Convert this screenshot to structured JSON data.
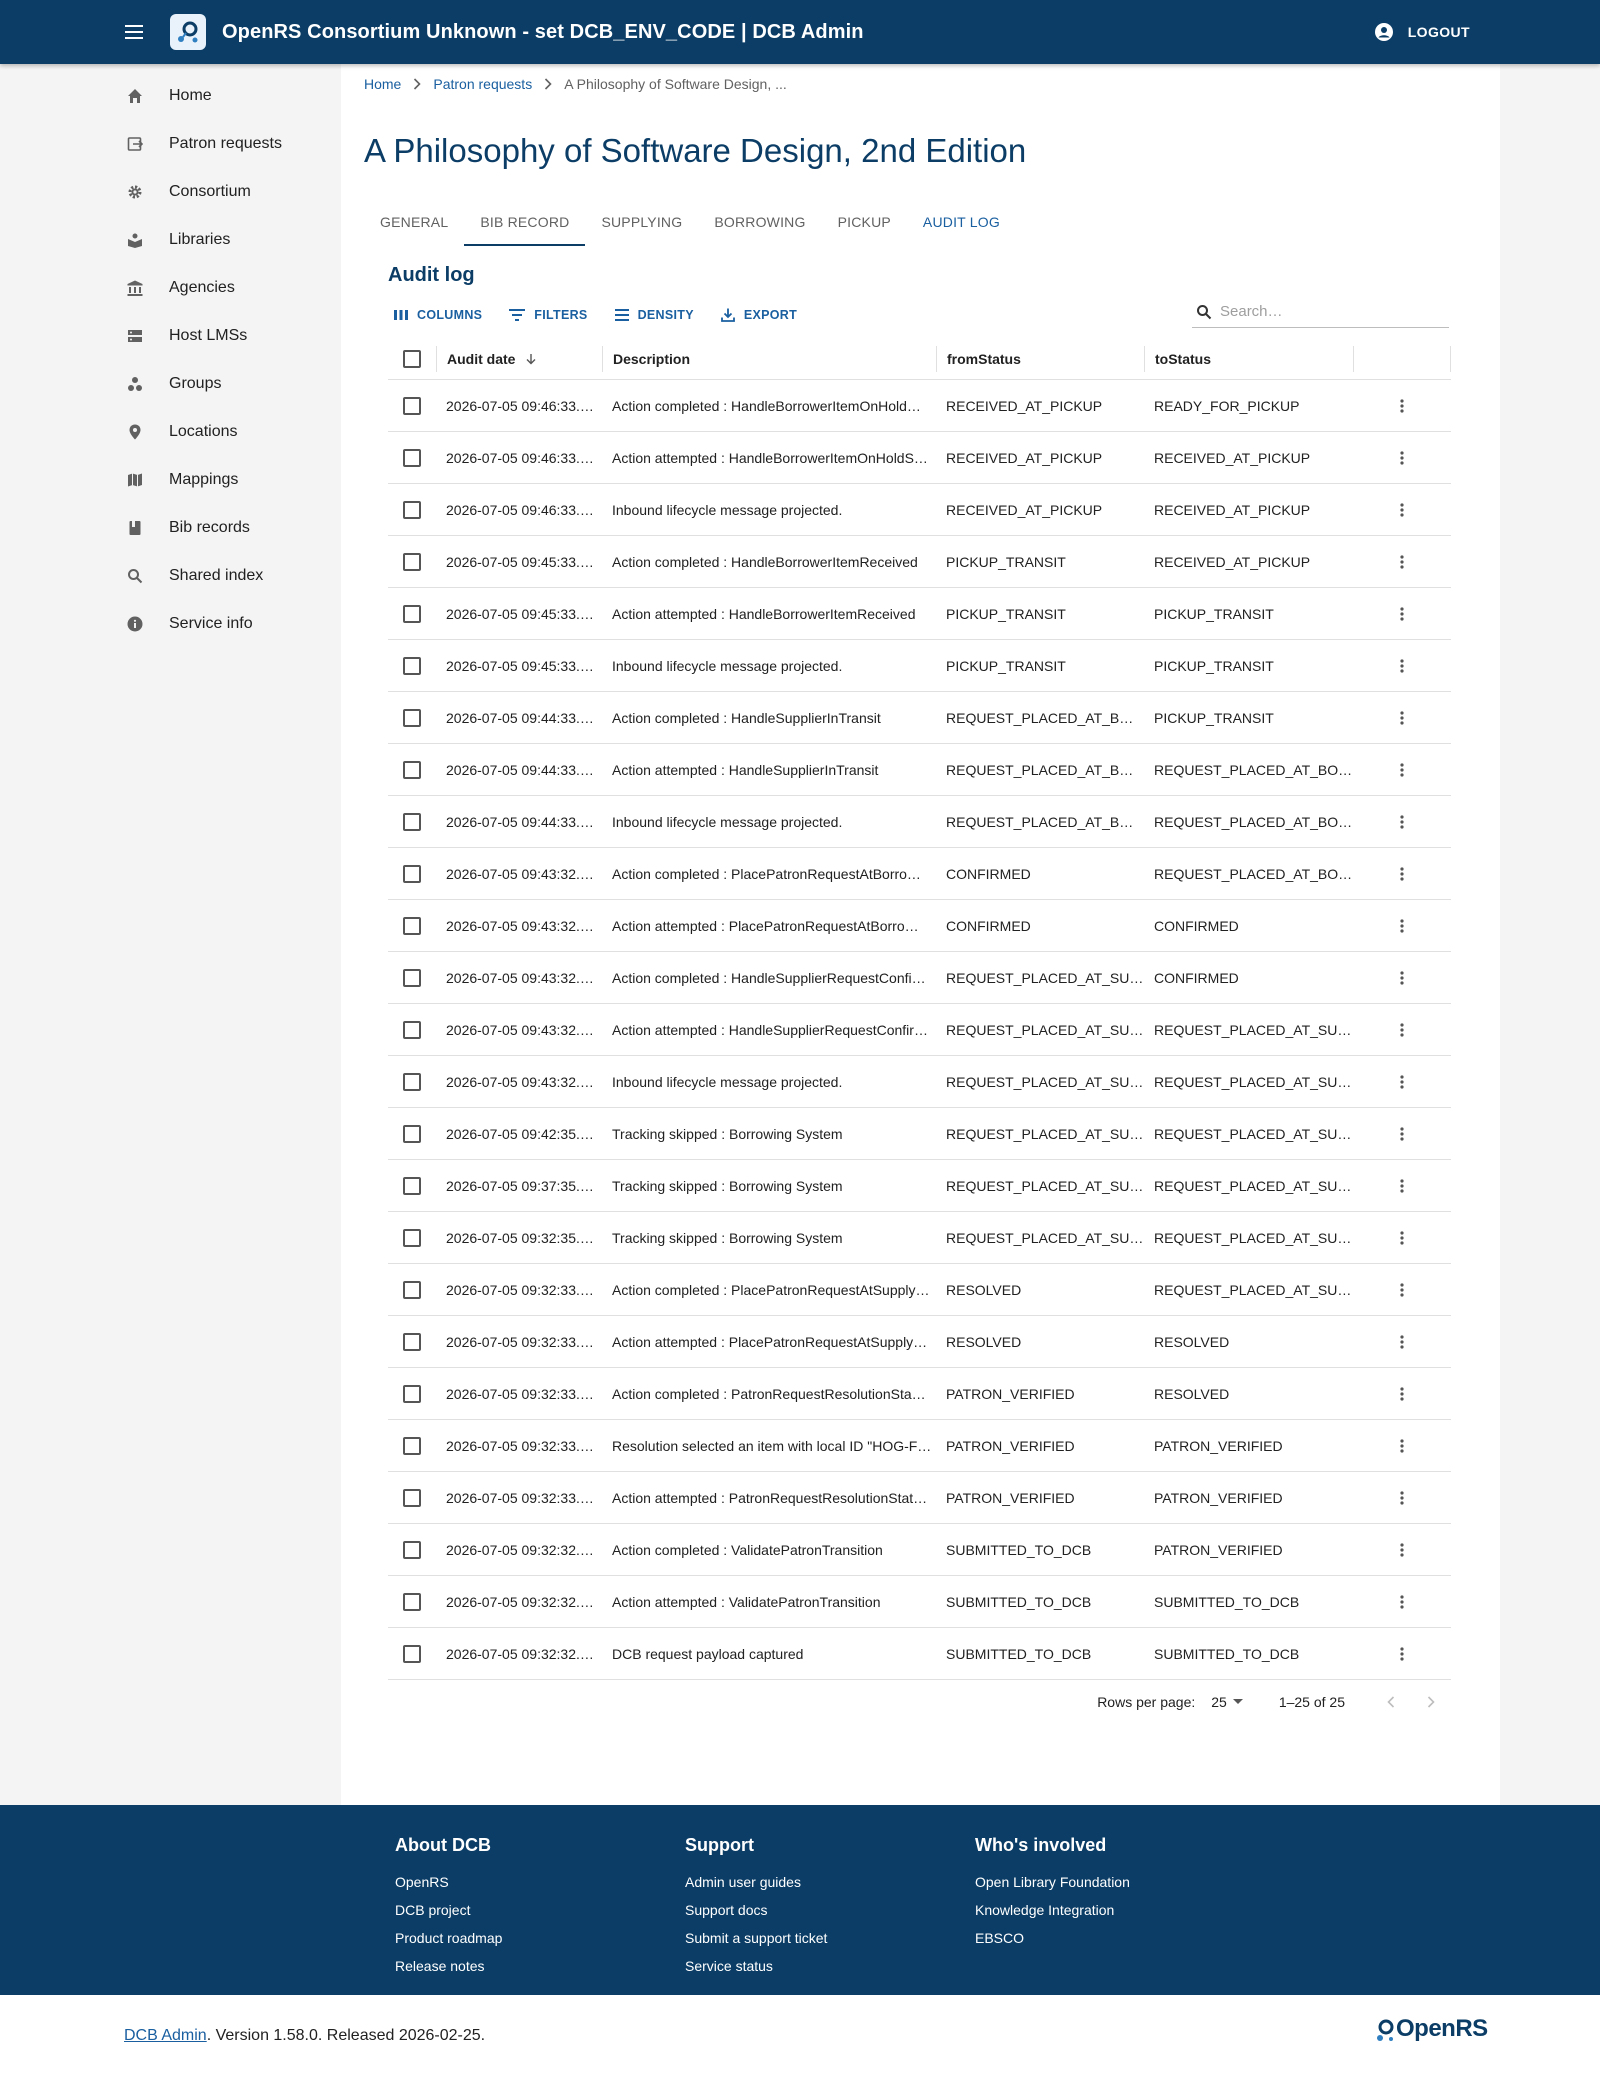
{
  "app": {
    "title": "OpenRS Consortium Unknown - set DCB_ENV_CODE | DCB Admin",
    "logout_label": "LOGOUT"
  },
  "sidebar": {
    "items": [
      {
        "label": "Home",
        "icon": "home-icon"
      },
      {
        "label": "Patron requests",
        "icon": "patron-requests-icon"
      },
      {
        "label": "Consortium",
        "icon": "gear-icon"
      },
      {
        "label": "Libraries",
        "icon": "libraries-icon"
      },
      {
        "label": "Agencies",
        "icon": "agencies-icon"
      },
      {
        "label": "Host LMSs",
        "icon": "host-lms-icon"
      },
      {
        "label": "Groups",
        "icon": "groups-icon"
      },
      {
        "label": "Locations",
        "icon": "location-pin-icon"
      },
      {
        "label": "Mappings",
        "icon": "map-icon"
      },
      {
        "label": "Bib records",
        "icon": "book-icon"
      },
      {
        "label": "Shared index",
        "icon": "search-icon"
      },
      {
        "label": "Service info",
        "icon": "info-icon"
      }
    ]
  },
  "breadcrumb": {
    "home": "Home",
    "patron_requests": "Patron requests",
    "current": "A Philosophy of Software Design, ..."
  },
  "page": {
    "title": "A Philosophy of Software Design, 2nd Edition"
  },
  "tabs": [
    "GENERAL",
    "BIB RECORD",
    "SUPPLYING",
    "BORROWING",
    "PICKUP",
    "AUDIT LOG"
  ],
  "audit": {
    "title": "Audit log",
    "toolbar": {
      "columns": "COLUMNS",
      "filters": "FILTERS",
      "density": "DENSITY",
      "export": "EXPORT"
    },
    "search_placeholder": "Search…",
    "columns": {
      "date": "Audit date",
      "description": "Description",
      "from": "fromStatus",
      "to": "toStatus"
    },
    "rows": [
      {
        "date": "2026-07-05 09:46:33.…",
        "desc": "Action completed : HandleBorrowerItemOnHold…",
        "from": "RECEIVED_AT_PICKUP",
        "to": "READY_FOR_PICKUP"
      },
      {
        "date": "2026-07-05 09:46:33.…",
        "desc": "Action attempted : HandleBorrowerItemOnHoldS…",
        "from": "RECEIVED_AT_PICKUP",
        "to": "RECEIVED_AT_PICKUP"
      },
      {
        "date": "2026-07-05 09:46:33.…",
        "desc": "Inbound lifecycle message projected.",
        "from": "RECEIVED_AT_PICKUP",
        "to": "RECEIVED_AT_PICKUP"
      },
      {
        "date": "2026-07-05 09:45:33.…",
        "desc": "Action completed : HandleBorrowerItemReceived",
        "from": "PICKUP_TRANSIT",
        "to": "RECEIVED_AT_PICKUP"
      },
      {
        "date": "2026-07-05 09:45:33.…",
        "desc": "Action attempted : HandleBorrowerItemReceived",
        "from": "PICKUP_TRANSIT",
        "to": "PICKUP_TRANSIT"
      },
      {
        "date": "2026-07-05 09:45:33.…",
        "desc": "Inbound lifecycle message projected.",
        "from": "PICKUP_TRANSIT",
        "to": "PICKUP_TRANSIT"
      },
      {
        "date": "2026-07-05 09:44:33.…",
        "desc": "Action completed : HandleSupplierInTransit",
        "from": "REQUEST_PLACED_AT_BOR…",
        "to": "PICKUP_TRANSIT"
      },
      {
        "date": "2026-07-05 09:44:33.…",
        "desc": "Action attempted : HandleSupplierInTransit",
        "from": "REQUEST_PLACED_AT_BOR…",
        "to": "REQUEST_PLACED_AT_BOR…"
      },
      {
        "date": "2026-07-05 09:44:33.…",
        "desc": "Inbound lifecycle message projected.",
        "from": "REQUEST_PLACED_AT_BOR…",
        "to": "REQUEST_PLACED_AT_BOR…"
      },
      {
        "date": "2026-07-05 09:43:32.…",
        "desc": "Action completed : PlacePatronRequestAtBorro…",
        "from": "CONFIRMED",
        "to": "REQUEST_PLACED_AT_BOR…"
      },
      {
        "date": "2026-07-05 09:43:32.…",
        "desc": "Action attempted : PlacePatronRequestAtBorro…",
        "from": "CONFIRMED",
        "to": "CONFIRMED"
      },
      {
        "date": "2026-07-05 09:43:32.…",
        "desc": "Action completed : HandleSupplierRequestConfi…",
        "from": "REQUEST_PLACED_AT_SUP…",
        "to": "CONFIRMED"
      },
      {
        "date": "2026-07-05 09:43:32.…",
        "desc": "Action attempted : HandleSupplierRequestConfir…",
        "from": "REQUEST_PLACED_AT_SUP…",
        "to": "REQUEST_PLACED_AT_SUP…"
      },
      {
        "date": "2026-07-05 09:43:32.…",
        "desc": "Inbound lifecycle message projected.",
        "from": "REQUEST_PLACED_AT_SUP…",
        "to": "REQUEST_PLACED_AT_SUP…"
      },
      {
        "date": "2026-07-05 09:42:35.…",
        "desc": "Tracking skipped : Borrowing System",
        "from": "REQUEST_PLACED_AT_SUP…",
        "to": "REQUEST_PLACED_AT_SUP…"
      },
      {
        "date": "2026-07-05 09:37:35.…",
        "desc": "Tracking skipped : Borrowing System",
        "from": "REQUEST_PLACED_AT_SUP…",
        "to": "REQUEST_PLACED_AT_SUP…"
      },
      {
        "date": "2026-07-05 09:32:35.…",
        "desc": "Tracking skipped : Borrowing System",
        "from": "REQUEST_PLACED_AT_SUP…",
        "to": "REQUEST_PLACED_AT_SUP…"
      },
      {
        "date": "2026-07-05 09:32:33.…",
        "desc": "Action completed : PlacePatronRequestAtSupply…",
        "from": "RESOLVED",
        "to": "REQUEST_PLACED_AT_SUP…"
      },
      {
        "date": "2026-07-05 09:32:33.…",
        "desc": "Action attempted : PlacePatronRequestAtSupply…",
        "from": "RESOLVED",
        "to": "RESOLVED"
      },
      {
        "date": "2026-07-05 09:32:33.…",
        "desc": "Action completed : PatronRequestResolutionSta…",
        "from": "PATRON_VERIFIED",
        "to": "RESOLVED"
      },
      {
        "date": "2026-07-05 09:32:33.…",
        "desc": "Resolution selected an item with local ID \"HOG-F…",
        "from": "PATRON_VERIFIED",
        "to": "PATRON_VERIFIED"
      },
      {
        "date": "2026-07-05 09:32:33.…",
        "desc": "Action attempted : PatronRequestResolutionStat…",
        "from": "PATRON_VERIFIED",
        "to": "PATRON_VERIFIED"
      },
      {
        "date": "2026-07-05 09:32:32.…",
        "desc": "Action completed : ValidatePatronTransition",
        "from": "SUBMITTED_TO_DCB",
        "to": "PATRON_VERIFIED"
      },
      {
        "date": "2026-07-05 09:32:32.…",
        "desc": "Action attempted : ValidatePatronTransition",
        "from": "SUBMITTED_TO_DCB",
        "to": "SUBMITTED_TO_DCB"
      },
      {
        "date": "2026-07-05 09:32:32.…",
        "desc": "DCB request payload captured",
        "from": "SUBMITTED_TO_DCB",
        "to": "SUBMITTED_TO_DCB"
      }
    ],
    "pagination": {
      "rows_per_page_label": "Rows per page:",
      "rows_per_page": "25",
      "range": "1–25 of 25"
    }
  },
  "footer": {
    "about": {
      "title": "About DCB",
      "links": [
        "OpenRS",
        "DCB project",
        "Product roadmap",
        "Release notes"
      ]
    },
    "support": {
      "title": "Support",
      "links": [
        "Admin user guides",
        "Support docs",
        "Submit a support ticket",
        "Service status"
      ]
    },
    "involved": {
      "title": "Who's involved",
      "links": [
        "Open Library Foundation",
        "Knowledge Integration",
        "EBSCO"
      ]
    },
    "version_link": "DCB Admin",
    "version_text": ". Version 1.58.0. Released 2026-02-25.",
    "logo_text": "OpenRS"
  },
  "colors": {
    "brand": "#0b3d66",
    "link": "#1a5fa0",
    "sidebar_bg": "#f4f4f4"
  }
}
